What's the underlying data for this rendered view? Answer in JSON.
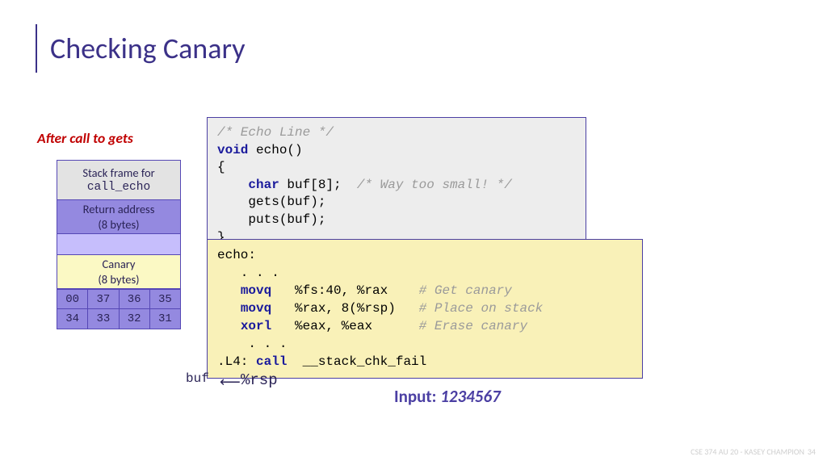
{
  "title": "Checking Canary",
  "subtitle": "After call to gets",
  "stack": {
    "frame_line1": "Stack frame for",
    "frame_line2": "call_echo",
    "retaddr_line1": "Return address",
    "retaddr_line2": "(8 bytes)",
    "canary_line1": "Canary",
    "canary_line2": "(8 bytes)",
    "row1": [
      "00",
      "37",
      "36",
      "35"
    ],
    "row2": [
      "34",
      "33",
      "32",
      "31"
    ]
  },
  "code_c": {
    "l1": "/* Echo Line */",
    "l2a": "void",
    "l2b": " echo()",
    "l3": "{",
    "l4a": "    ",
    "l4b": "char",
    "l4c": " buf[8];  ",
    "l4d": "/* Way too small! */",
    "l5": "    gets(buf);",
    "l6": "    puts(buf);",
    "l7": "}"
  },
  "code_asm": {
    "l1": "echo:",
    "l2": "   . . .",
    "l3a": "   ",
    "l3b": "movq",
    "l3c": "   %fs:40, %rax    ",
    "l3d": "# Get canary",
    "l4a": "   ",
    "l4b": "movq",
    "l4c": "   %rax, 8(%rsp)   ",
    "l4d": "# Place on stack",
    "l5a": "   ",
    "l5b": "xorl",
    "l5c": "   %eax, %eax      ",
    "l5d": "# Erase canary",
    "l6": "    . . .",
    "l7a": ".L4: ",
    "l7b": "call",
    "l7c": "  __stack_chk_fail"
  },
  "labels": {
    "buf": "buf",
    "rsp": "%rsp",
    "input_label": "Input: ",
    "input_value": "1234567"
  },
  "footer": "CSE 374 AU 20 - KASEY CHAMPION",
  "page": "34"
}
